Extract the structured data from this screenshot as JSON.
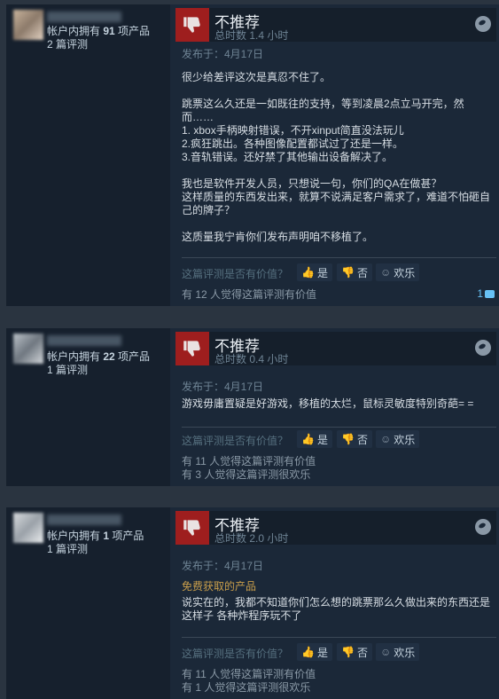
{
  "reviews": [
    {
      "owned_prefix": "帐户内拥有 ",
      "owned_count": "91",
      "owned_suffix": " 项产品",
      "review_count": "2 篇评测",
      "verdict": "不推荐",
      "hours": "总时数 1.4 小时",
      "posted": "发布于：4月17日",
      "free_product": "",
      "body": "很少给差评这次是真忍不住了。\n\n跳票这么久还是一如既往的支持，等到凌晨2点立马开完，然而……\n1. xbox手柄映射错误，不开xinput简直没法玩儿\n2.疯狂跳出。各种图像配置都试过了还是一样。\n3.音轨错误。还好禁了其他输出设备解决了。\n\n我也是软件开发人员，只想说一句，你们的QA在做甚？\n这样质量的东西发出来，就算不说满足客户需求了，难道不怕砸自己的牌子？\n\n这质量我宁肯你们发布声明咱不移植了。",
      "helpful_question": "这篇评测是否有价值？",
      "btn_yes": "是",
      "btn_no": "否",
      "btn_funny": "欢乐",
      "stat1": "有 12 人觉得这篇评测有价值",
      "stat2": "",
      "comments": "1"
    },
    {
      "owned_prefix": "帐户内拥有 ",
      "owned_count": "22",
      "owned_suffix": " 项产品",
      "review_count": "1 篇评测",
      "verdict": "不推荐",
      "hours": "总时数 0.4 小时",
      "posted": "发布于：4月17日",
      "free_product": "",
      "body": "游戏毋庸置疑是好游戏，移植的太烂，鼠标灵敏度特别奇葩= =",
      "helpful_question": "这篇评测是否有价值？",
      "btn_yes": "是",
      "btn_no": "否",
      "btn_funny": "欢乐",
      "stat1": "有 11 人觉得这篇评测有价值",
      "stat2": "有 3 人觉得这篇评测很欢乐",
      "comments": ""
    },
    {
      "owned_prefix": "帐户内拥有 ",
      "owned_count": "1",
      "owned_suffix": " 项产品",
      "review_count": "1 篇评测",
      "verdict": "不推荐",
      "hours": "总时数 2.0 小时",
      "posted": "发布于：4月17日",
      "free_product": "免费获取的产品",
      "body": "说实在的，我都不知道你们怎么想的跳票那么久做出来的东西还是这样子 各种炸程序玩不了",
      "helpful_question": "这篇评测是否有价值？",
      "btn_yes": "是",
      "btn_no": "否",
      "btn_funny": "欢乐",
      "stat1": "有 11 人觉得这篇评测有价值",
      "stat2": "有 1 人觉得这篇评测很欢乐",
      "comments": ""
    }
  ],
  "icons": {
    "thumbs_down": "thumbs-down-icon",
    "thumbs_up": "thumbs-up-icon",
    "smile": "smile-icon",
    "steam": "steam-icon",
    "comment": "comment-bubble-icon"
  },
  "colors": {
    "page_bg": "#2a3440",
    "card_bg": "#1b2838",
    "thumb_box": "#9e1e1e",
    "link_blue": "#67c1f5",
    "free_label": "#c99e4b"
  }
}
